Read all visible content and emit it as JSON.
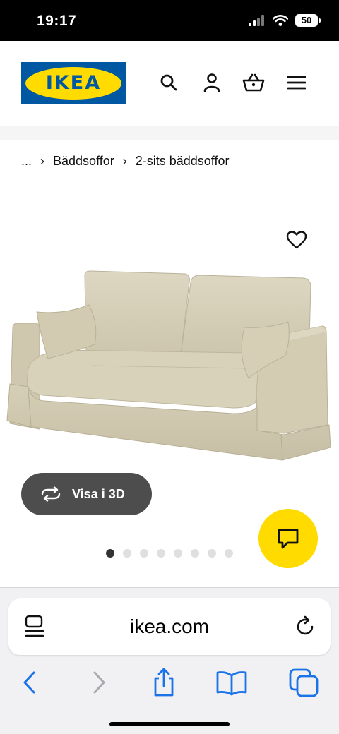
{
  "status_bar": {
    "time": "19:17",
    "battery": "50"
  },
  "header": {
    "logo_text": "IKEA",
    "icons": [
      "search-icon",
      "user-icon",
      "cart-icon",
      "menu-icon"
    ]
  },
  "breadcrumb": {
    "ellipsis": "...",
    "items": [
      "Bäddsoffor",
      "2-sits bäddsoffor"
    ]
  },
  "product": {
    "view_3d_label": "Visa i 3D",
    "image_count": 8,
    "active_image": 1
  },
  "browser": {
    "url": "ikea.com"
  },
  "colors": {
    "ikea_blue": "#0058a3",
    "ikea_yellow": "#ffdb00",
    "ios_blue": "#1a73e8"
  }
}
